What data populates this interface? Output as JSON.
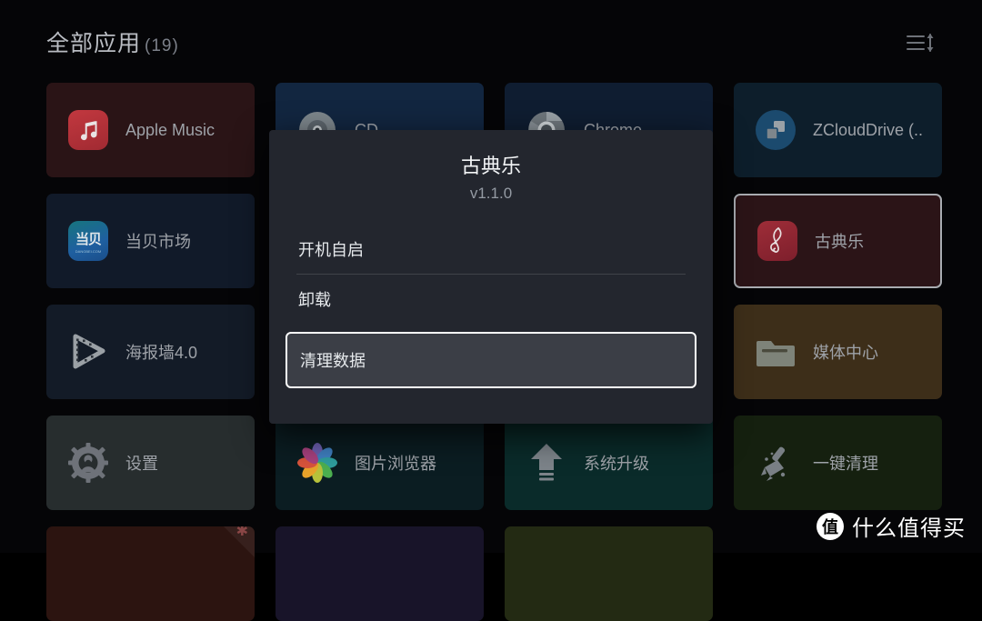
{
  "header": {
    "title": "全部应用",
    "count": "(19)",
    "sort_icon": "sort-lines-arrow-icon"
  },
  "grid": {
    "tiles": [
      {
        "label": "Apple Music",
        "icon": "apple-music-icon",
        "bg": "#2a1416",
        "selected": false,
        "starred": false,
        "col": 0,
        "row": 0
      },
      {
        "label": "CD",
        "icon": "compact-disc-icon",
        "bg": "#122640",
        "selected": false,
        "starred": false,
        "col": 1,
        "row": 0
      },
      {
        "label": "Chrome",
        "icon": "chrome-icon",
        "bg": "#0f1d31",
        "selected": false,
        "starred": false,
        "col": 2,
        "row": 0
      },
      {
        "label": "ZCloudDrive (..",
        "icon": "zclouddrive-icon",
        "bg": "#0d1e2b",
        "selected": false,
        "starred": false,
        "col": 3,
        "row": 0
      },
      {
        "label": "当贝市场",
        "icon": "dangbei-market-icon",
        "bg": "#111a29",
        "selected": false,
        "starred": false,
        "col": 0,
        "row": 1
      },
      {
        "label": "古典乐",
        "icon": "treble-clef-icon",
        "bg": "#2b1417",
        "selected": true,
        "starred": false,
        "col": 3,
        "row": 1
      },
      {
        "label": "海报墙4.0",
        "icon": "film-strip-play-icon",
        "bg": "#131b27",
        "selected": false,
        "starred": false,
        "col": 0,
        "row": 2
      },
      {
        "label": "媒体中心",
        "icon": "folder-icon",
        "bg": "#3d2e19",
        "selected": false,
        "starred": false,
        "col": 3,
        "row": 2
      },
      {
        "label": "设置",
        "icon": "gear-icon",
        "bg": "#272d2e",
        "selected": false,
        "starred": false,
        "col": 0,
        "row": 3
      },
      {
        "label": "图片浏览器",
        "icon": "photo-pinwheel-icon",
        "bg": "#0b1d22",
        "selected": false,
        "starred": false,
        "col": 1,
        "row": 3
      },
      {
        "label": "系统升级",
        "icon": "upload-arrow-icon",
        "bg": "#0a2b2a",
        "selected": false,
        "starred": false,
        "col": 2,
        "row": 3
      },
      {
        "label": "一键清理",
        "icon": "broom-icon",
        "bg": "#15200f",
        "selected": false,
        "starred": false,
        "col": 3,
        "row": 3
      }
    ],
    "partial_tiles": [
      {
        "bg": "#2c1410",
        "starred": true,
        "col": 0
      },
      {
        "bg": "#181429",
        "starred": false,
        "col": 1
      },
      {
        "bg": "#232a13",
        "starred": false,
        "col": 2
      }
    ]
  },
  "dialog": {
    "title": "古典乐",
    "version": "v1.1.0",
    "items": [
      {
        "label": "开机自启",
        "focused": false
      },
      {
        "label": "卸载",
        "focused": false
      },
      {
        "label": "清理数据",
        "focused": true
      }
    ]
  },
  "watermark": {
    "badge": "值",
    "text": "什么值得买"
  },
  "colors": {
    "page_background": "#050507",
    "dialog_background": "#23262e",
    "focus_border": "#ffffff",
    "tile_selected_border": "#a9acb1",
    "label_text": "#9ea2a8",
    "title_text": "#b9bcc2"
  }
}
